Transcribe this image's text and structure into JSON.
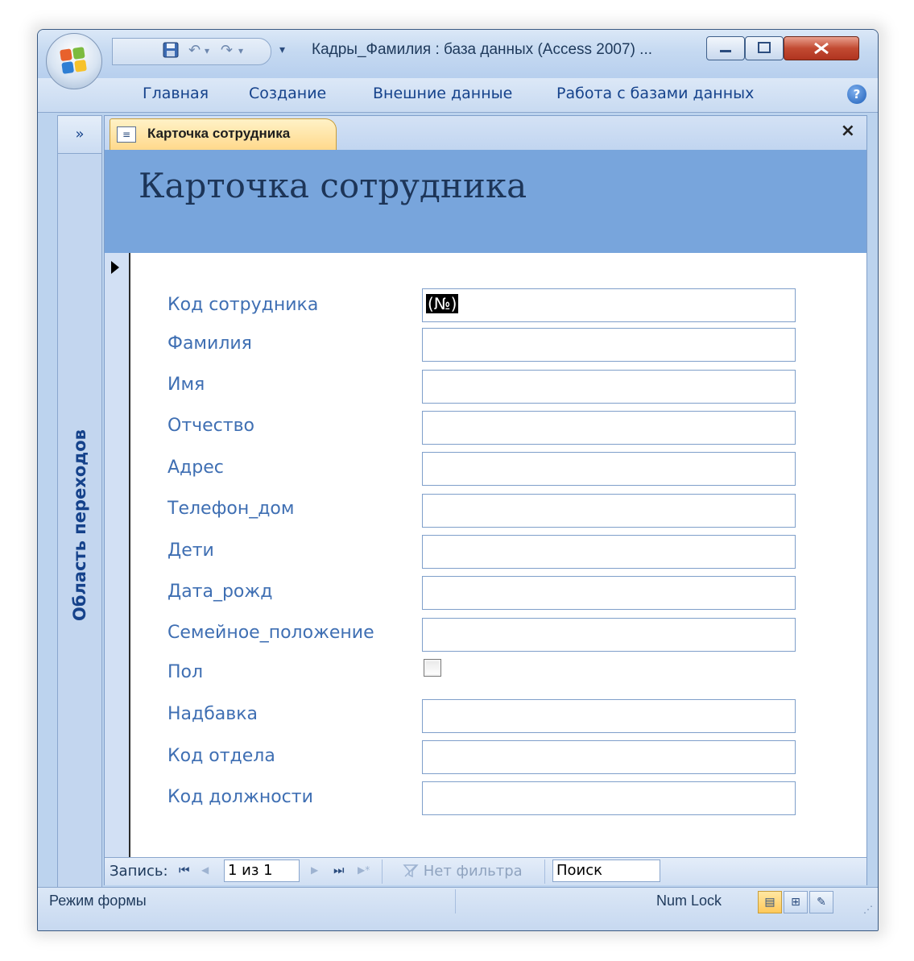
{
  "window": {
    "title": "Кадры_Фамилия : база данных (Access 2007) ..."
  },
  "quick_access": {
    "icons": [
      "save-icon",
      "undo-icon",
      "redo-icon",
      "customize-icon"
    ]
  },
  "ribbon": {
    "tabs": [
      "Главная",
      "Создание",
      "Внешние данные",
      "Работа с базами данных"
    ],
    "help_glyph": "?"
  },
  "nav_pane": {
    "chevron": "»",
    "label": "Область переходов"
  },
  "document_tab": {
    "label": "Карточка сотрудника",
    "close_glyph": "×"
  },
  "form": {
    "title": "Карточка сотрудника",
    "fields": [
      {
        "label": "Код сотрудника",
        "value": "(№)",
        "type": "text"
      },
      {
        "label": "Фамилия",
        "value": "",
        "type": "text"
      },
      {
        "label": "Имя",
        "value": "",
        "type": "text"
      },
      {
        "label": "Отчество",
        "value": "",
        "type": "text"
      },
      {
        "label": "Адрес",
        "value": "",
        "type": "text"
      },
      {
        "label": "Телефон_дом",
        "value": "",
        "type": "text"
      },
      {
        "label": "Дети",
        "value": "",
        "type": "text"
      },
      {
        "label": "Дата_рожд",
        "value": "",
        "type": "text"
      },
      {
        "label": "Семейное_положение",
        "value": "",
        "type": "text"
      },
      {
        "label": "Пол",
        "value": "",
        "type": "checkbox"
      },
      {
        "label": "Надбавка",
        "value": "",
        "type": "text"
      },
      {
        "label": "Код отдела",
        "value": "",
        "type": "text"
      },
      {
        "label": "Код должности",
        "value": "",
        "type": "text"
      }
    ]
  },
  "record_nav": {
    "label": "Запись:",
    "position": "1 из 1",
    "filter": "Нет фильтра",
    "search": "Поиск",
    "first_glyph": "⏮",
    "prev_glyph": "◀",
    "next_glyph": "▶",
    "last_glyph": "⏭",
    "new_glyph": "▶*"
  },
  "status_bar": {
    "mode": "Режим формы",
    "numlock": "Num Lock",
    "views": [
      "form-view-icon",
      "datasheet-view-icon",
      "design-view-icon"
    ]
  },
  "colors": {
    "header_band": "#78a5dc",
    "label_text": "#3f6fb3",
    "title_text": "#1d3558",
    "tab_active": "#ffd88a"
  }
}
